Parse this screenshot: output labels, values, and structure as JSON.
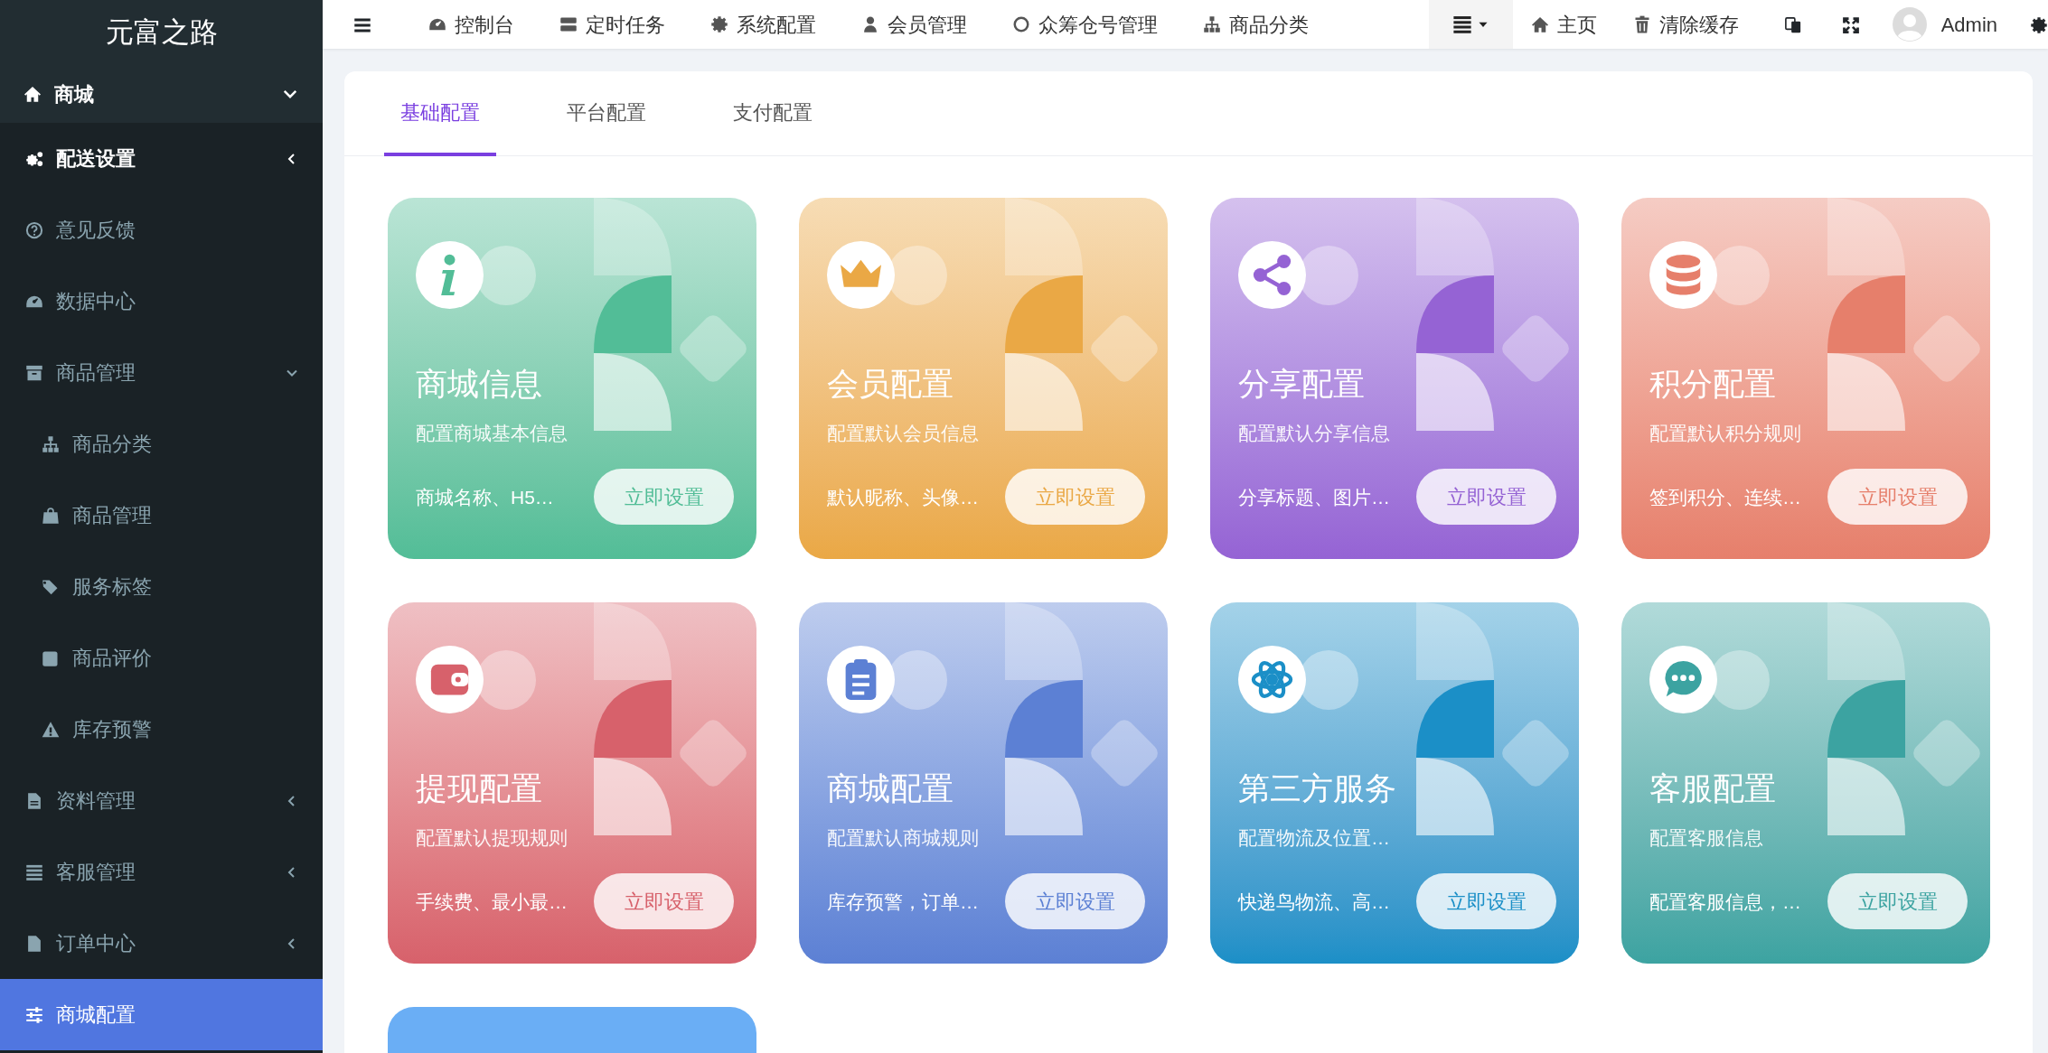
{
  "sidebar": {
    "brand": "元富之路",
    "section": {
      "label": "商城",
      "expanded": true
    },
    "items": [
      {
        "label": "配送设置",
        "selected": false,
        "highlighted": true,
        "expanded": false
      },
      {
        "label": "意见反馈",
        "selected": false,
        "highlighted": false
      },
      {
        "label": "数据中心",
        "selected": false,
        "highlighted": false
      },
      {
        "label": "商品管理",
        "selected": false,
        "highlighted": false,
        "expanded": true,
        "children": [
          {
            "label": "商品分类",
            "selected": false
          },
          {
            "label": "商品管理",
            "selected": false
          },
          {
            "label": "服务标签",
            "selected": false
          },
          {
            "label": "商品评价",
            "selected": false
          },
          {
            "label": "库存预警",
            "selected": false
          }
        ]
      },
      {
        "label": "资料管理",
        "selected": false,
        "highlighted": false,
        "expanded": false
      },
      {
        "label": "客服管理",
        "selected": false,
        "highlighted": false,
        "expanded": false
      },
      {
        "label": "订单中心",
        "selected": false,
        "highlighted": false,
        "expanded": false
      },
      {
        "label": "商城配置",
        "selected": true,
        "highlighted": false
      }
    ]
  },
  "topbar": {
    "nav": [
      {
        "label": "控制台"
      },
      {
        "label": "定时任务"
      },
      {
        "label": "系统配置"
      },
      {
        "label": "会员管理"
      },
      {
        "label": "众筹仓号管理"
      },
      {
        "label": "商品分类"
      }
    ],
    "links": [
      {
        "label": "主页"
      },
      {
        "label": "清除缓存"
      }
    ],
    "user": {
      "name": "Admin"
    }
  },
  "tabs": [
    {
      "label": "基础配置",
      "selected": true
    },
    {
      "label": "平台配置",
      "selected": false
    },
    {
      "label": "支付配置",
      "selected": false
    }
  ],
  "cards": [
    {
      "title": "商城信息",
      "description": "配置商城基本信息",
      "details": "商城名称、H5…",
      "button": "立即设置",
      "color": "#52bd97"
    },
    {
      "title": "会员配置",
      "description": "配置默认会员信息",
      "details": "默认昵称、头像…",
      "button": "立即设置",
      "color": "#eaa845"
    },
    {
      "title": "分享配置",
      "description": "配置默认分享信息",
      "details": "分享标题、图片…",
      "button": "立即设置",
      "color": "#9563d4"
    },
    {
      "title": "积分配置",
      "description": "配置默认积分规则",
      "details": "签到积分、连续…",
      "button": "立即设置",
      "color": "#e67f6b"
    },
    {
      "title": "提现配置",
      "description": "配置默认提现规则",
      "details": "手续费、最小最…",
      "button": "立即设置",
      "color": "#d7616b"
    },
    {
      "title": "商城配置",
      "description": "配置默认商城规则",
      "details": "库存预警，订单…",
      "button": "立即设置",
      "color": "#5c80d4"
    },
    {
      "title": "第三方服务",
      "description": "配置物流及位置…",
      "details": "快递鸟物流、高…",
      "button": "立即设置",
      "color": "#1b8fc7"
    },
    {
      "title": "客服配置",
      "description": "配置客服信息",
      "details": "配置客服信息，…",
      "button": "立即设置",
      "color": "#3ca3a1"
    }
  ],
  "clipped_card": {
    "color": "#6aaef5"
  }
}
